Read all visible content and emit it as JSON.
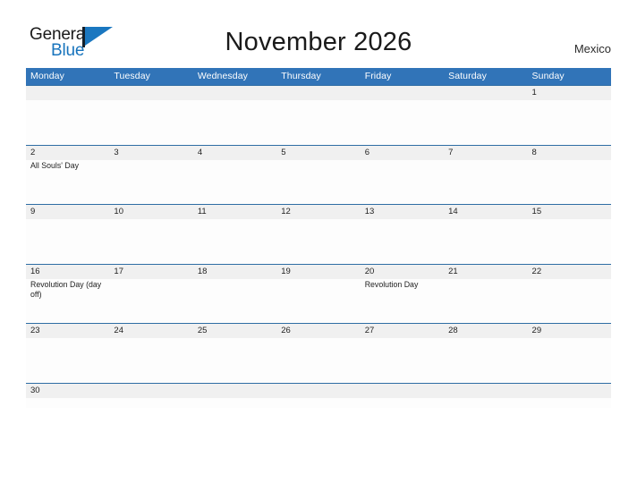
{
  "brand": {
    "name_part1": "General",
    "name_part2": "Blue",
    "flag_icon": "flag-icon"
  },
  "header": {
    "title": "November 2026",
    "country": "Mexico"
  },
  "calendar": {
    "month": "November",
    "year": "2026",
    "weekday_headers": [
      "Monday",
      "Tuesday",
      "Wednesday",
      "Thursday",
      "Friday",
      "Saturday",
      "Sunday"
    ],
    "weeks": [
      {
        "dates": [
          "",
          "",
          "",
          "",
          "",
          "",
          "1"
        ],
        "events": [
          "",
          "",
          "",
          "",
          "",
          "",
          ""
        ]
      },
      {
        "dates": [
          "2",
          "3",
          "4",
          "5",
          "6",
          "7",
          "8"
        ],
        "events": [
          "All Souls' Day",
          "",
          "",
          "",
          "",
          "",
          ""
        ]
      },
      {
        "dates": [
          "9",
          "10",
          "11",
          "12",
          "13",
          "14",
          "15"
        ],
        "events": [
          "",
          "",
          "",
          "",
          "",
          "",
          ""
        ]
      },
      {
        "dates": [
          "16",
          "17",
          "18",
          "19",
          "20",
          "21",
          "22"
        ],
        "events": [
          "Revolution Day (day off)",
          "",
          "",
          "",
          "Revolution Day",
          "",
          ""
        ]
      },
      {
        "dates": [
          "23",
          "24",
          "25",
          "26",
          "27",
          "28",
          "29"
        ],
        "events": [
          "",
          "",
          "",
          "",
          "",
          "",
          ""
        ]
      },
      {
        "dates": [
          "30",
          "",
          "",
          "",
          "",
          "",
          ""
        ],
        "events": [
          "",
          "",
          "",
          "",
          "",
          "",
          ""
        ]
      }
    ]
  },
  "colors": {
    "header_blue": "#3174b8",
    "row_border_blue": "#2e6da4",
    "date_band_gray": "#f0f0f0",
    "brand_blue": "#1874bd",
    "text_dark": "#1f1f1f"
  }
}
